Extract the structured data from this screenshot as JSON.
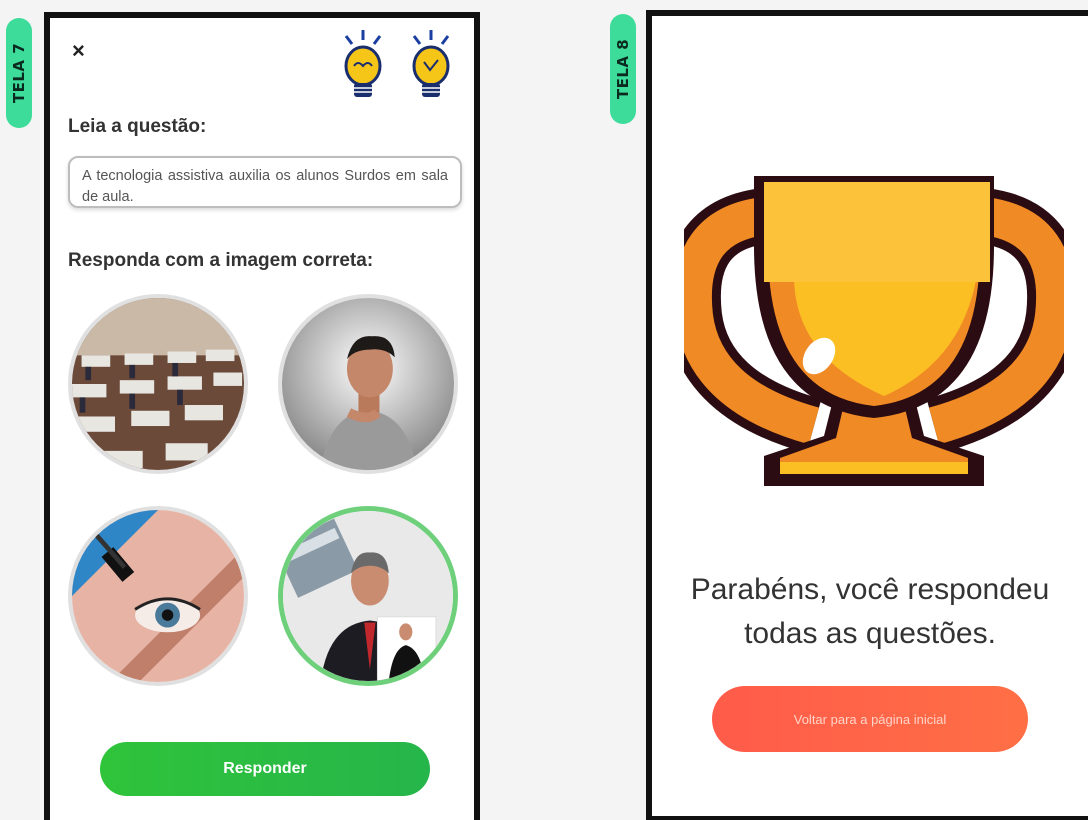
{
  "screens": {
    "tela7": {
      "tag": "TELA 7",
      "close_symbol": "×",
      "icons": [
        "lightbulb-icon",
        "lightbulb-icon"
      ],
      "question_heading": "Leia a questão:",
      "question_text": "A tecnologia assistiva auxilia os alunos Surdos em sala de aula.",
      "answer_heading": "Responda com a imagem correta:",
      "options": [
        {
          "image": "empty-classroom-desks"
        },
        {
          "image": "man-thinking"
        },
        {
          "image": "eye-with-mascara"
        },
        {
          "image": "man-presenting-with-sign-language-interpreter",
          "selected": true
        }
      ],
      "submit_label": "Responder",
      "colors": {
        "accent_green": "#2fc43a",
        "selected_border": "#6ed07a"
      }
    },
    "tela8": {
      "tag": "TELA 8",
      "trophy_icon": "trophy-icon",
      "message_line1": "Parabéns, você respondeu",
      "message_line2": "todas as questões.",
      "back_button_label": "Voltar para a página inicial",
      "colors": {
        "button": "#ff5b4a",
        "trophy_gold": "#fbbf24",
        "trophy_orange": "#f08a24"
      }
    }
  },
  "colors": {
    "tag_bg": "#3ddc9a",
    "phone_frame": "#111111"
  }
}
